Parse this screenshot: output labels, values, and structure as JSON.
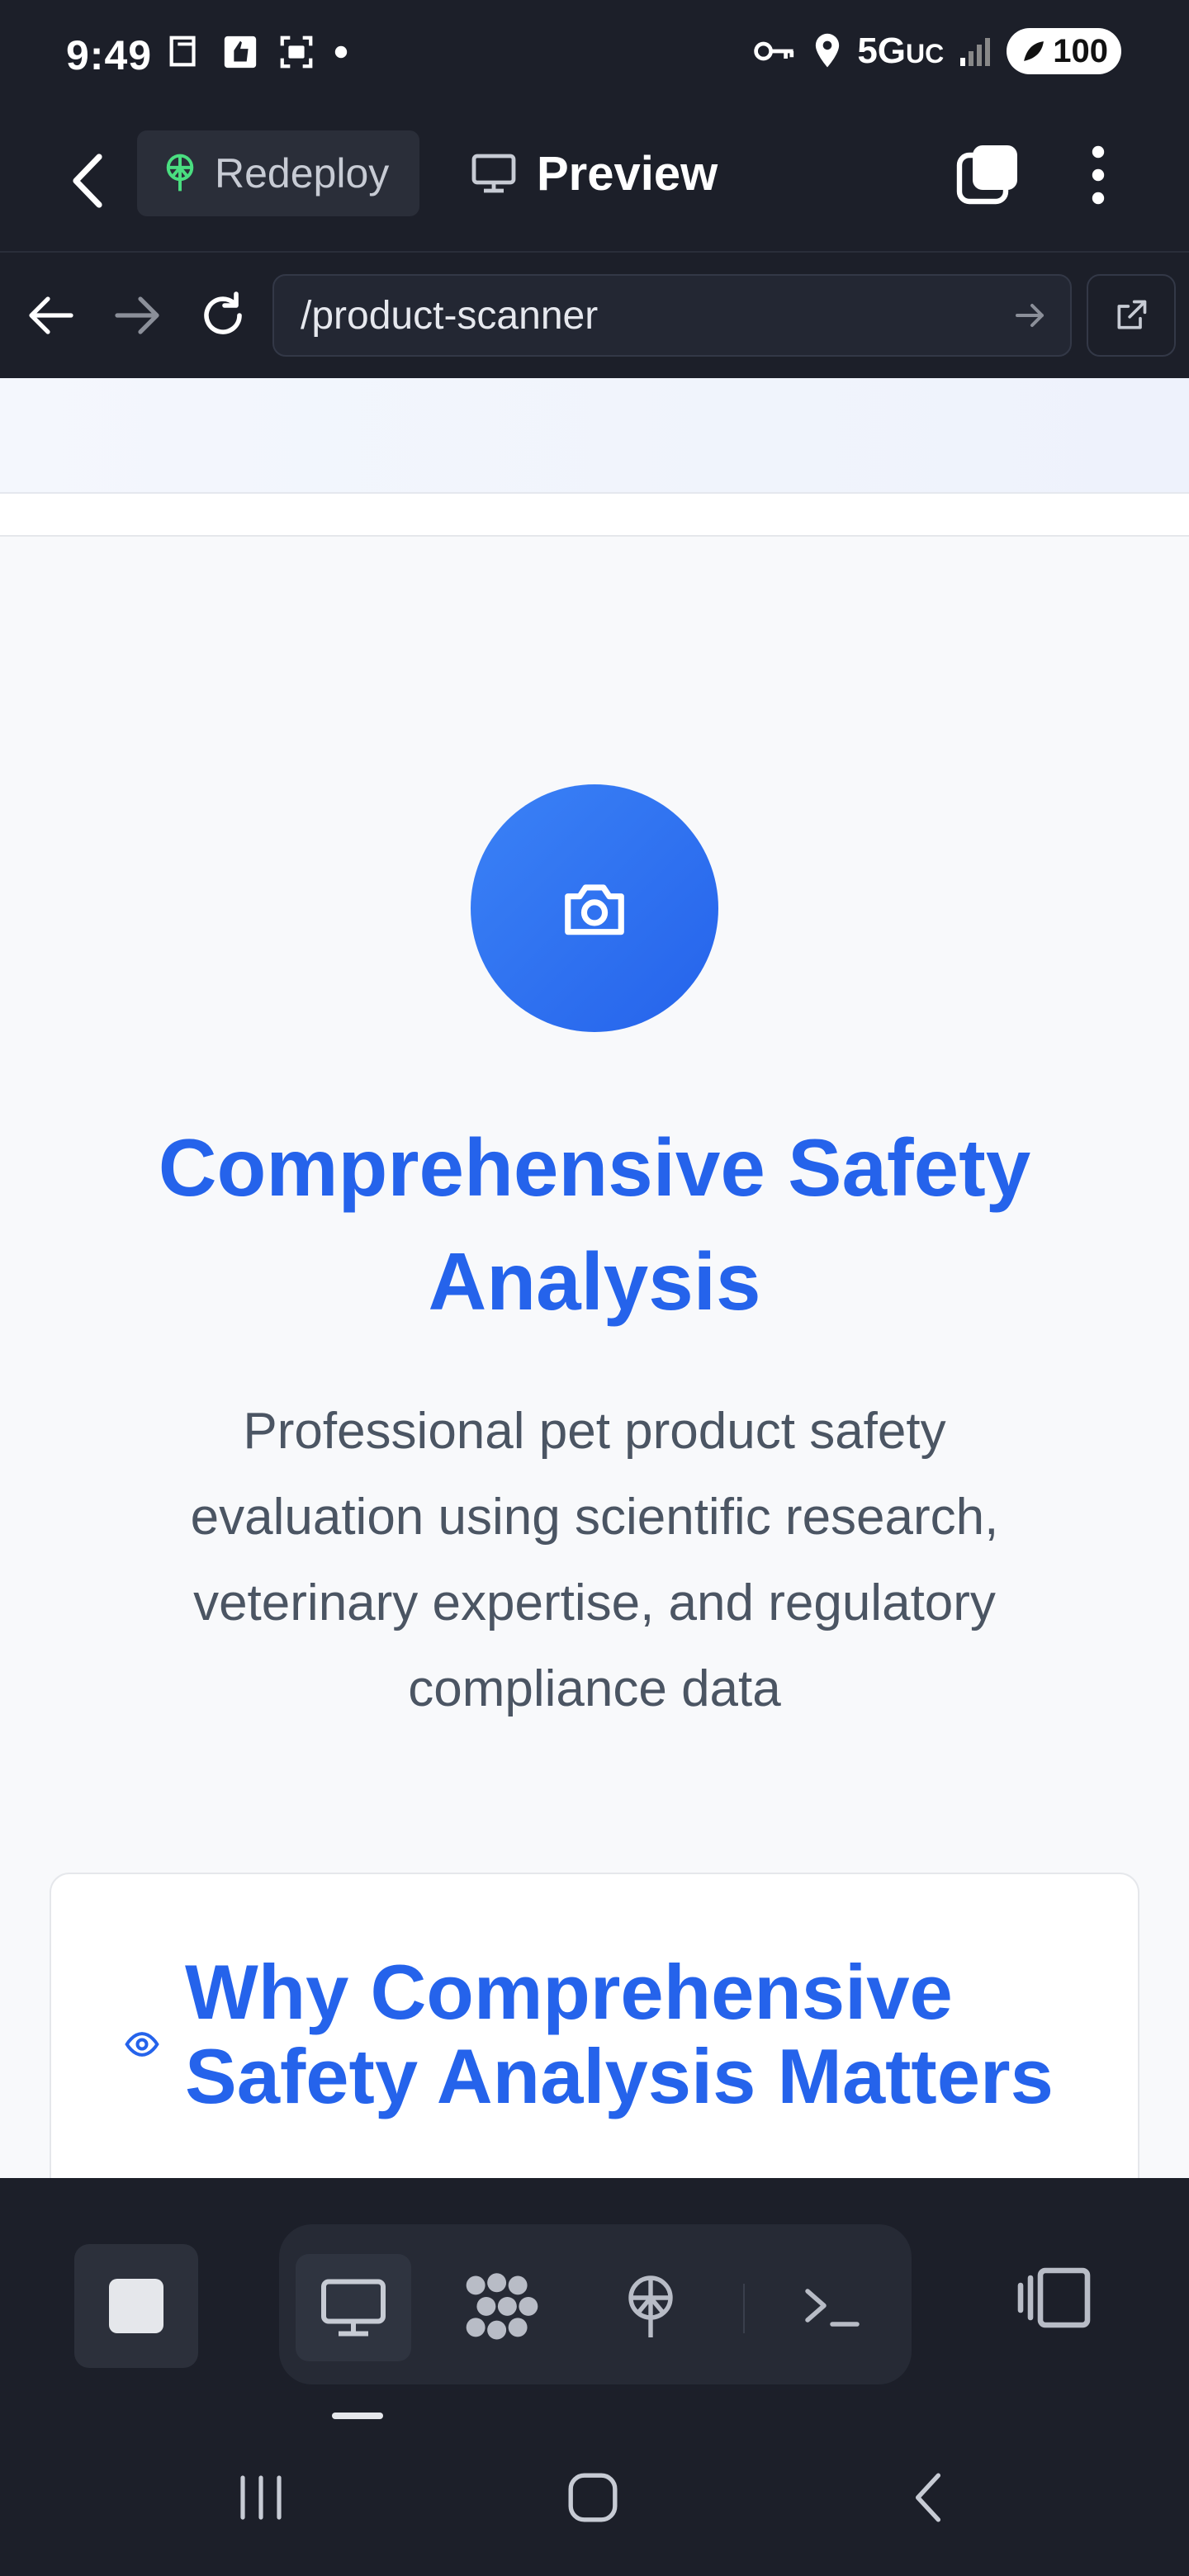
{
  "status_bar": {
    "time": "9:49",
    "network": "5G",
    "network_suffix": "UC",
    "battery": "100"
  },
  "app_bar": {
    "redeploy_label": "Redeploy",
    "preview_label": "Preview"
  },
  "url_bar": {
    "url": "/product-scanner"
  },
  "hero": {
    "title": "Comprehensive Safety Analysis",
    "description": "Professional pet product safety evaluation using scientific research, veterinary expertise, and regulatory compliance data"
  },
  "why_card": {
    "title": "Why Comprehensive Safety Analysis Matters"
  },
  "colors": {
    "accent": "#2563eb",
    "chrome": "#1c1f29",
    "redeploy_icon": "#4ade80"
  },
  "icons": [
    "back-icon",
    "redeploy-icon",
    "monitor-icon",
    "tabs-icon",
    "more-icon",
    "arrow-left-icon",
    "arrow-right-icon",
    "reload-icon",
    "go-arrow-icon",
    "external-link-icon",
    "camera-icon",
    "eye-icon",
    "stop-icon",
    "apps-icon",
    "deploy-icon",
    "terminal-icon",
    "panel-icon"
  ]
}
